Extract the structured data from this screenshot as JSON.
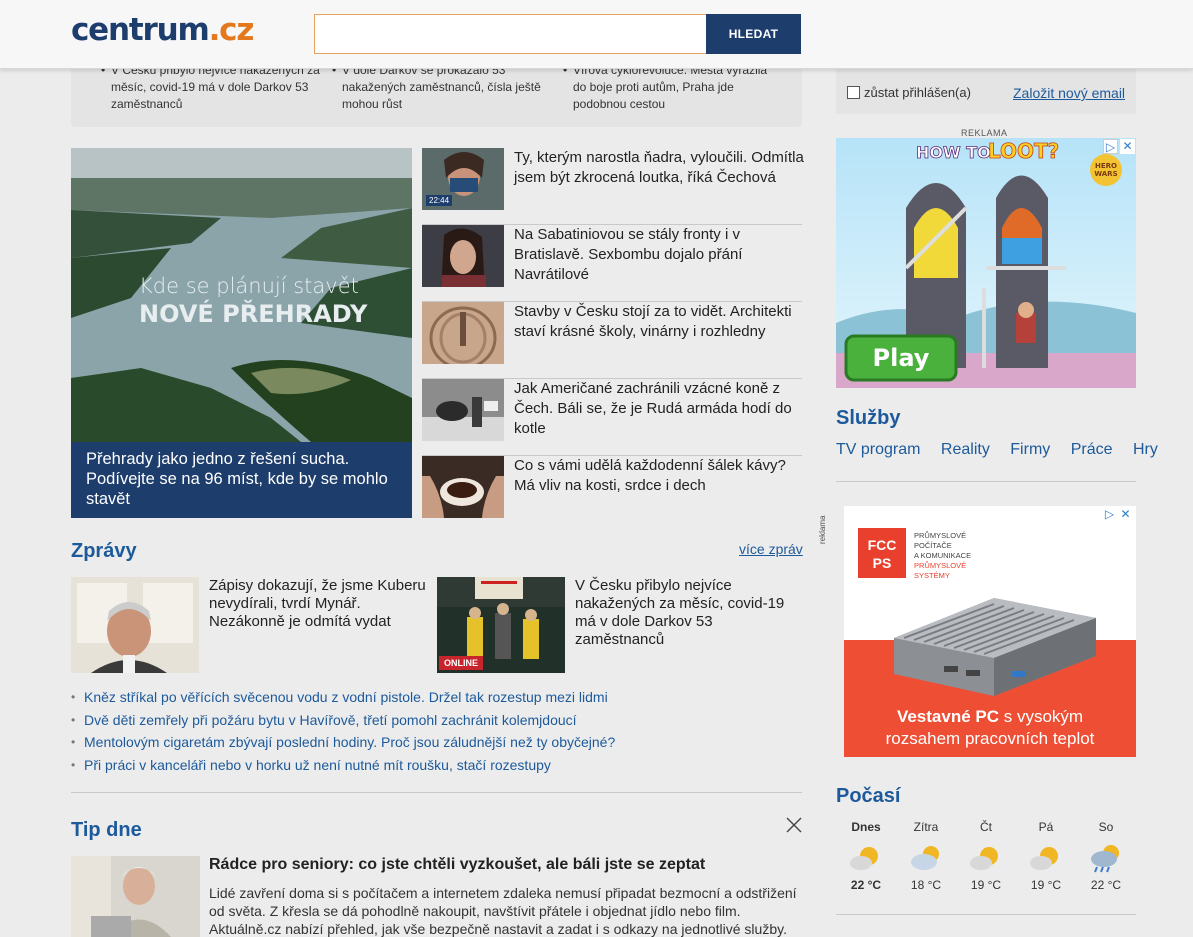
{
  "header": {
    "logo_part1": "centrum",
    "logo_part2": ".cz",
    "search_placeholder": "",
    "search_button": "HLEDAT"
  },
  "top_strip": [
    "V Česku přibylo nejvíce nakažených za měsíc, covid-19 má v dole Darkov 53 zaměstnanců",
    "V dole Darkov se prokázalo 53 nakažených zaměstnanců, čísla ještě mohou růst",
    "Vírová cyklorevoluce. Města vyrazila do boje proti autům, Praha jde podobnou cestou"
  ],
  "login": {
    "stay_logged": "zůstat přihlášen(a)",
    "new_email": "Založit nový email"
  },
  "hero": {
    "overlay_line1": "Kde se plánují stavět",
    "overlay_line2": "NOVÉ PŘEHRADY",
    "caption": "Přehrady jako jedno z řešení sucha. Podívejte se na 96 míst, kde by se mohlo stavět"
  },
  "articles": [
    {
      "title": "Ty, kterým narostla ňadra, vyloučili. Odmítla jsem být zkrocená loutka, říká Čechová",
      "badge": "22:44"
    },
    {
      "title": "Na Sabatiniovou se stály fronty i v Bratislavě. Sexbombu dojalo přání Navrátilové"
    },
    {
      "title": "Stavby v Česku stojí za to vidět. Architekti staví krásné školy, vinárny i rozhledny"
    },
    {
      "title": "Jak Američané zachránili vzácné koně z Čech. Báli se, že je Rudá armáda hodí do kotle"
    },
    {
      "title": "Co s vámi udělá každodenní šálek kávy? Má vliv na kosti, srdce i dech"
    }
  ],
  "zpravy": {
    "title": "Zprávy",
    "more": "více zpráv",
    "featured": [
      {
        "title": "Zápisy dokazují, že jsme Kuberu nevydírali, tvrdí Mynář. Nezákonně je odmítá vydat"
      },
      {
        "title": "V Česku přibylo nejvíce nakažených za měsíc, covid-19 má v dole Darkov 53 zaměstnanců",
        "badge": "ONLINE"
      }
    ],
    "links": [
      "Kněz stříkal po věřících svěcenou vodu z vodní pistole. Držel tak rozestup mezi lidmi",
      "Dvě děti zemřely při požáru bytu v Havířově, třetí pomohl zachránit kolemjdoucí",
      "Mentolovým cigaretám zbývají poslední hodiny. Proč jsou záludnější než ty obyčejné?",
      "Při práci v kanceláři nebo v horku už není nutné mít roušku, stačí rozestupy"
    ]
  },
  "tip": {
    "title": "Tip dne",
    "headline": "Rádce pro seniory: co jste chtěli vyzkoušet, ale báli jste se zeptat",
    "text": "Lidé zavření doma si s počítačem a internetem zdaleka nemusí připadat bezmocní a odstřižení od světa. Z křesla se dá pohodlně nakoupit, navštívit přátele i objednat jídlo nebo film. Aktuálně.cz nabízí přehled, jak vše bezpečně nastavit a zadat i s odkazy na jednotlivé služby."
  },
  "sidebar": {
    "reklama": "REKLAMA",
    "reklama_vertical": "reklama",
    "ad1": {
      "line1": "HOW TO",
      "line2": "LOOT?",
      "button": "Play",
      "brand1": "HERO",
      "brand2": "WARS"
    },
    "sluzby_title": "Služby",
    "sluzby": [
      "TV program",
      "Reality",
      "Firmy",
      "Práce",
      "Hry"
    ],
    "ad2": {
      "logo_top": "FCC",
      "logo_bottom": "PS",
      "tag1": "PRŮMYSLOVÉ",
      "tag2": "POČÍTAČE",
      "tag3": "A KOMUNIKACE",
      "tag4": "PRŮMYSLOVÉ",
      "tag5": "SYSTÉMY",
      "line1_bold": "Vestavné PC",
      "line1_rest": " s vysokým",
      "line2": "rozsahem pracovních teplot"
    },
    "pocasi_title": "Počasí",
    "weather": [
      {
        "day": "Dnes",
        "temp": "22 °C",
        "icon": "partly-sunny-icon"
      },
      {
        "day": "Zítra",
        "temp": "18 °C",
        "icon": "cloudy-sunny-icon"
      },
      {
        "day": "Čt",
        "temp": "19 °C",
        "icon": "partly-sunny-icon"
      },
      {
        "day": "Pá",
        "temp": "19 °C",
        "icon": "partly-sunny-icon"
      },
      {
        "day": "So",
        "temp": "22 °C",
        "icon": "rain-icon"
      }
    ]
  }
}
